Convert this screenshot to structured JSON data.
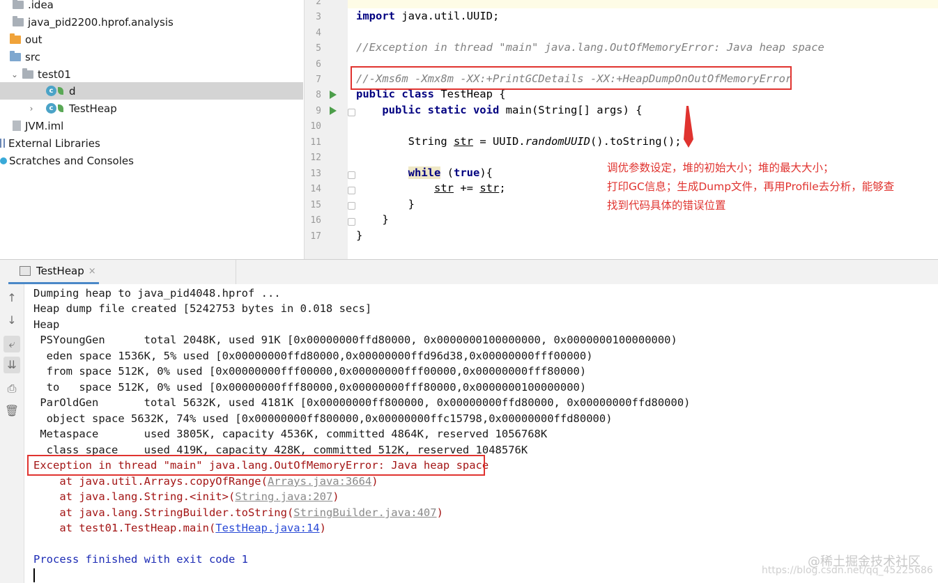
{
  "project_tree": {
    "items": [
      {
        "label": ".idea"
      },
      {
        "label": "java_pid2200.hprof.analysis"
      },
      {
        "label": "out"
      },
      {
        "label": "src"
      },
      {
        "label": "test01"
      },
      {
        "label": "d"
      },
      {
        "label": "TestHeap"
      },
      {
        "label": "JVM.iml"
      },
      {
        "label": "External Libraries"
      },
      {
        "label": "Scratches and Consoles"
      }
    ]
  },
  "editor": {
    "line_numbers": [
      "2",
      "3",
      "4",
      "5",
      "6",
      "7",
      "8",
      "9",
      "10",
      "11",
      "12",
      "13",
      "14",
      "15",
      "16",
      "17"
    ],
    "lines": {
      "l3_kw": "import",
      "l3_rest": " java.util.UUID;",
      "l5": "//Exception in thread \"main\" java.lang.OutOfMemoryError: Java heap space",
      "l7": "//-Xms6m -Xmx8m -XX:+PrintGCDetails -XX:+HeapDumpOnOutOfMemoryError",
      "l8_kw": "public class",
      "l8_rest": " TestHeap {",
      "l9_indent": "    ",
      "l9_kw": "public static void",
      "l9_rest": " main(String[] args) {",
      "l11_a": "        String ",
      "l11_b": "str",
      "l11_c": " = UUID.",
      "l11_d": "randomUUID",
      "l11_e": "().toString();",
      "l13_indent": "        ",
      "l13_kw": "while",
      "l13_mid": " (",
      "l13_kw2": "true",
      "l13_end": "){",
      "l14_indent": "            ",
      "l14_a": "str",
      "l14_b": " += ",
      "l14_c": "str",
      "l14_d": ";",
      "l15": "        }",
      "l16": "    }",
      "l17": "}"
    },
    "annotation": [
      "调优参数设定，堆的初始大小；堆的最大大小；",
      "打印GC信息；生成Dump文件，再用Profile去分析，能够查",
      "找到代码具体的错误位置"
    ]
  },
  "run_panel": {
    "tab_label": "TestHeap",
    "tab_close": "×",
    "console": {
      "lines": [
        "Dumping heap to java_pid4048.hprof ...",
        "Heap dump file created [5242753 bytes in 0.018 secs]",
        "Heap",
        " PSYoungGen      total 2048K, used 91K [0x00000000ffd80000, 0x0000000100000000, 0x0000000100000000)",
        "  eden space 1536K, 5% used [0x00000000ffd80000,0x00000000ffd96d38,0x00000000fff00000)",
        "  from space 512K, 0% used [0x00000000fff00000,0x00000000fff00000,0x00000000fff80000)",
        "  to   space 512K, 0% used [0x00000000fff80000,0x00000000fff80000,0x0000000100000000)",
        " ParOldGen       total 5632K, used 4181K [0x00000000ff800000, 0x00000000ffd80000, 0x00000000ffd80000)",
        "  object space 5632K, 74% used [0x00000000ff800000,0x00000000ffc15798,0x00000000ffd80000)",
        " Metaspace       used 3805K, capacity 4536K, committed 4864K, reserved 1056768K",
        "  class space    used 419K, capacity 428K, committed 512K, reserved 1048576K"
      ],
      "exception": "Exception in thread \"main\" java.lang.OutOfMemoryError: Java heap space",
      "stack": [
        {
          "prefix": "    at java.util.Arrays.copyOfRange(",
          "link": "Arrays.java:3664",
          "suffix": ")"
        },
        {
          "prefix": "    at java.lang.String.<init>(",
          "link": "String.java:207",
          "suffix": ")"
        },
        {
          "prefix": "    at java.lang.StringBuilder.toString(",
          "link": "StringBuilder.java:407",
          "suffix": ")"
        },
        {
          "prefix": "    at test01.TestHeap.main(",
          "link": "TestHeap.java:14",
          "suffix": ")"
        }
      ],
      "finished": "Process finished with exit code 1"
    }
  },
  "watermarks": {
    "line1": "@稀土掘金技术社区",
    "line2": "https://blog.csdn.net/qq_45225686"
  },
  "colors": {
    "highlight_red": "#e0332f",
    "keyword": "#000080",
    "error_text": "#a31515",
    "run_green": "#4c9e4a"
  }
}
